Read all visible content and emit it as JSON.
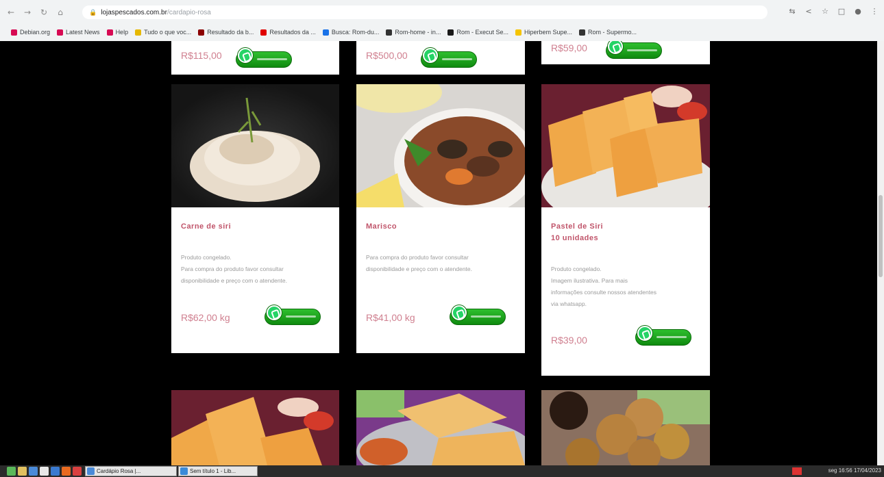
{
  "browser": {
    "url_host": "lojaspescados.com.br",
    "url_path": "/cardapio-rosa",
    "bookmarks": [
      {
        "label": "Debian.org",
        "color": "#d70a53"
      },
      {
        "label": "Latest News",
        "color": "#d70a53"
      },
      {
        "label": "Help",
        "color": "#d70a53"
      },
      {
        "label": "Tudo o que voc...",
        "color": "#e6b800"
      },
      {
        "label": "Resultado da b...",
        "color": "#8b0000"
      },
      {
        "label": "Resultados da ...",
        "color": "#e00000"
      },
      {
        "label": "Busca: Rom-du...",
        "color": "#1a73e8"
      },
      {
        "label": "Rom-home - in...",
        "color": "#333333"
      },
      {
        "label": "Rom - Execut Se...",
        "color": "#1a1a1a"
      },
      {
        "label": "Hiperbem Supe...",
        "color": "#f5c400"
      },
      {
        "label": "Rom - Supermo...",
        "color": "#333333"
      }
    ]
  },
  "top_row": [
    {
      "price": "R$115,00"
    },
    {
      "price": "R$500,00"
    },
    {
      "price": "R$59,00"
    }
  ],
  "products": [
    {
      "title": "Carne de siri",
      "desc": [
        "Produto congelado.",
        "Para compra do produto favor consultar",
        "disponibilidade e preço com o atendente."
      ],
      "price": "R$62,00 kg"
    },
    {
      "title": "Marisco",
      "desc": [
        "Para compra do produto favor consultar",
        "disponibilidade e preço com o atendente."
      ],
      "price": "R$41,00 kg"
    },
    {
      "title": "Pastel de Siri",
      "title2": "10 unidades",
      "desc": [
        "Produto congelado.",
        "Imagem ilustrativa. Para mais",
        "informações consulte nossos atendentes",
        "via whatsapp."
      ],
      "price": "R$39,00"
    }
  ],
  "taskbar": {
    "windows": [
      "Cardápio Rosa |...",
      "Sem título 1 - Lib..."
    ],
    "clock": "seg 16:56 17/04/2023"
  },
  "colors": {
    "accent_title": "#c0546a",
    "price": "#d08090",
    "whatsapp": "#25d366"
  }
}
